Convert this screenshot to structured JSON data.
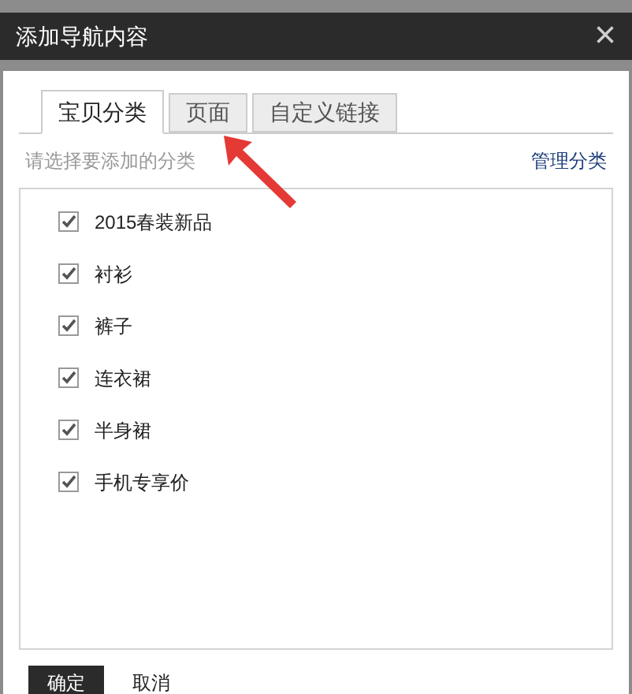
{
  "window": {
    "title": "添加导航内容",
    "close": "×"
  },
  "tabs": [
    {
      "label": "宝贝分类",
      "selected": true
    },
    {
      "label": "页面",
      "selected": false
    },
    {
      "label": "自定义链接",
      "selected": false
    }
  ],
  "hint": "请选择要添加的分类",
  "manage_link": "管理分类",
  "categories": [
    {
      "label": "2015春装新品",
      "checked": true
    },
    {
      "label": "衬衫",
      "checked": true
    },
    {
      "label": "裤子",
      "checked": true
    },
    {
      "label": "连衣裙",
      "checked": true
    },
    {
      "label": "半身裙",
      "checked": true
    },
    {
      "label": "手机专享价",
      "checked": true
    }
  ],
  "buttons": [
    {
      "label": "确定",
      "kind": "primary"
    },
    {
      "label": "取消",
      "kind": "plain"
    }
  ]
}
